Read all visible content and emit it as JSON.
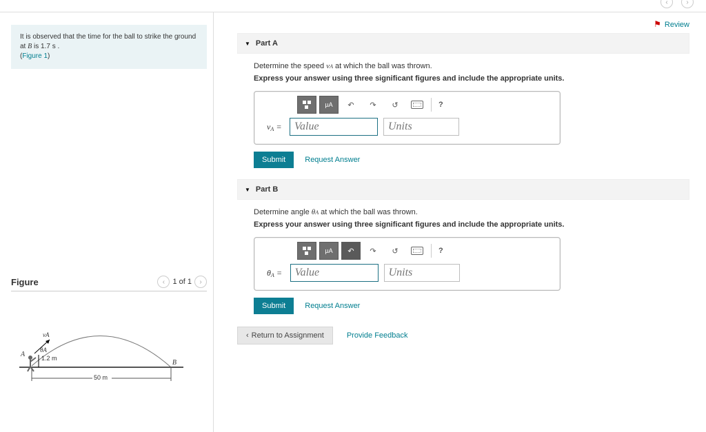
{
  "top": {
    "title_fragment": "",
    "page_indicator": "",
    "prev_aria": "previous problem",
    "next_aria": "next problem"
  },
  "review_link": "Review",
  "problem": {
    "line1_pre": "It is observed that the time for the ball to strike the ground at ",
    "B_var": "B",
    "line1_mid": " is ",
    "time_val": "1.7 s",
    "line1_post": ".",
    "figure_link": "Figure 1"
  },
  "figure_panel": {
    "title": "Figure",
    "nav_text": "1 of 1"
  },
  "figure_labels": {
    "vA": "vA",
    "thetaA": "θA",
    "ptA": "A",
    "ptB": "B",
    "h": "1.2 m",
    "d": "50 m"
  },
  "parts": {
    "A": {
      "header": "Part A",
      "prompt_pre": "Determine the speed ",
      "symbol_main": "v",
      "symbol_sub": "A",
      "prompt_post": " at which the ball was thrown.",
      "instruction": "Express your answer using three significant figures and include the appropriate units.",
      "lhs_main": "v",
      "lhs_sub": "A",
      "value_ph": "Value",
      "units_ph": "Units",
      "submit": "Submit",
      "request": "Request Answer"
    },
    "B": {
      "header": "Part B",
      "prompt_pre": "Determine angle ",
      "symbol_main": "θ",
      "symbol_sub": "A",
      "prompt_post": " at which the ball was thrown.",
      "instruction": "Express your answer using three significant figures and include the appropriate units.",
      "lhs_main": "θ",
      "lhs_sub": "A",
      "value_ph": "Value",
      "units_ph": "Units",
      "submit": "Submit",
      "request": "Request Answer"
    }
  },
  "footer": {
    "return_label": "Return to Assignment",
    "feedback_label": "Provide Feedback"
  },
  "toolbar": {
    "templates": "templates",
    "symbols": "µA",
    "undo": "undo",
    "redo": "redo",
    "reset": "reset",
    "keyboard": "keyboard shortcuts",
    "help": "?"
  }
}
